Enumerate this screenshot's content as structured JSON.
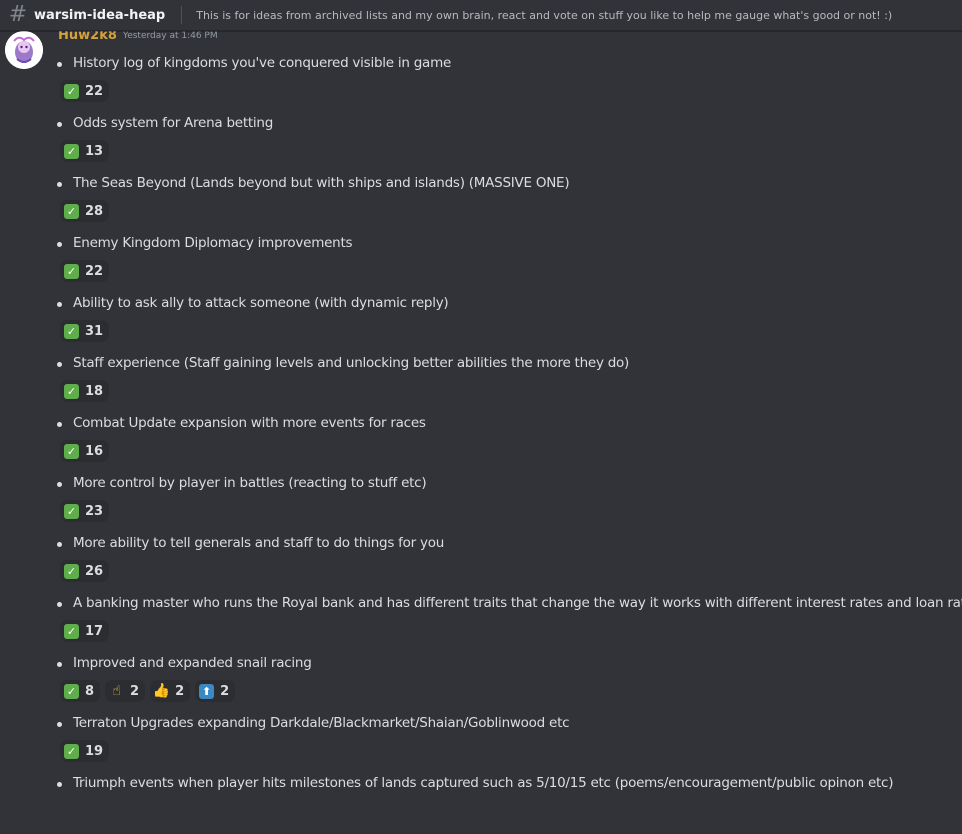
{
  "header": {
    "icon": "hash-icon",
    "channel_name": "warsim-idea-heap",
    "topic": "This is for ideas from archived lists and my own brain, react and vote on stuff you like to help me gauge what's good or not! :)"
  },
  "message": {
    "author": "Huw2k8",
    "timestamp": "Yesterday at 1:46 PM",
    "author_color": "#d4a23a",
    "ideas": [
      {
        "text": "History log of kingdoms you've conquered visible in game",
        "reactions": [
          {
            "emoji": "check-mark-icon",
            "count": "22"
          }
        ]
      },
      {
        "text": "Odds system for Arena betting",
        "reactions": [
          {
            "emoji": "check-mark-icon",
            "count": "13"
          }
        ]
      },
      {
        "text": "The Seas Beyond (Lands beyond but with ships and islands) (MASSIVE ONE)",
        "reactions": [
          {
            "emoji": "check-mark-icon",
            "count": "28"
          }
        ]
      },
      {
        "text": "Enemy Kingdom Diplomacy improvements",
        "reactions": [
          {
            "emoji": "check-mark-icon",
            "count": "22"
          }
        ]
      },
      {
        "text": "Ability to ask ally to attack someone (with dynamic reply)",
        "reactions": [
          {
            "emoji": "check-mark-icon",
            "count": "31"
          }
        ]
      },
      {
        "text": "Staff experience (Staff gaining levels and unlocking better abilities the more they do)",
        "reactions": [
          {
            "emoji": "check-mark-icon",
            "count": "18"
          }
        ]
      },
      {
        "text": "Combat Update expansion with more events for races",
        "reactions": [
          {
            "emoji": "check-mark-icon",
            "count": "16"
          }
        ]
      },
      {
        "text": "More control by player in battles (reacting to stuff etc)",
        "reactions": [
          {
            "emoji": "check-mark-icon",
            "count": "23"
          }
        ]
      },
      {
        "text": "More ability to tell generals and staff to do things for you",
        "reactions": [
          {
            "emoji": "check-mark-icon",
            "count": "26"
          }
        ]
      },
      {
        "text": "A banking master who runs the Royal bank and has different traits that change the way it works with different interest rates and loan rates",
        "reactions": [
          {
            "emoji": "check-mark-icon",
            "count": "17"
          }
        ]
      },
      {
        "text": "Improved and expanded snail racing",
        "reactions": [
          {
            "emoji": "check-mark-icon",
            "count": "8"
          },
          {
            "emoji": "pointing-up-icon",
            "count": "2"
          },
          {
            "emoji": "thumbs-up-icon",
            "count": "2"
          },
          {
            "emoji": "up-arrow-icon",
            "count": "2"
          }
        ]
      },
      {
        "text": "Terraton Upgrades expanding Darkdale/Blackmarket/Shaian/Goblinwood etc",
        "reactions": [
          {
            "emoji": "check-mark-icon",
            "count": "19"
          }
        ]
      },
      {
        "text": "Triumph events when player hits milestones of lands captured such as 5/10/15 etc (poems/encouragement/public opinon etc)",
        "reactions": []
      }
    ]
  }
}
